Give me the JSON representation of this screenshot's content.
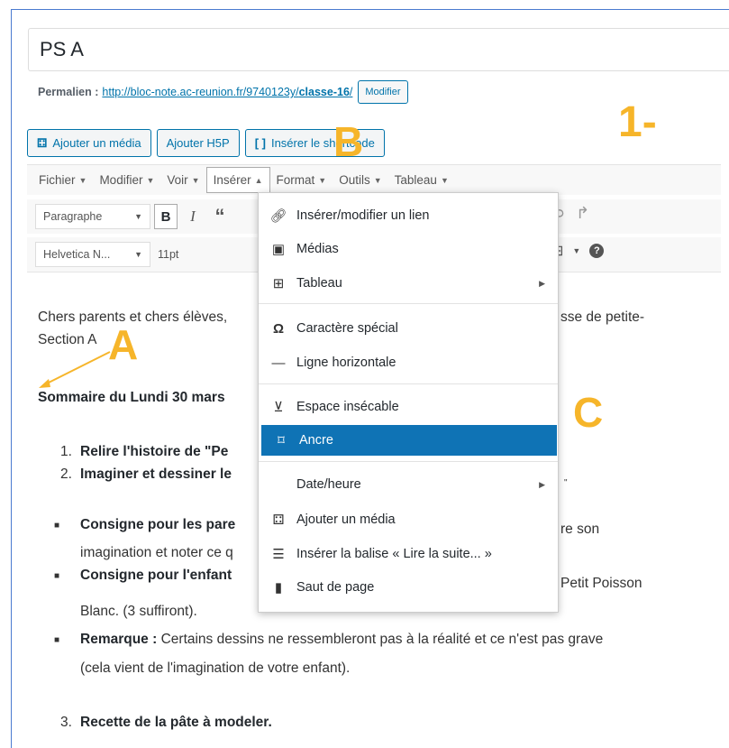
{
  "title_field": {
    "value": "PS A"
  },
  "permalink": {
    "label": "Permalien :",
    "url_base": "http://bloc-note.ac-reunion.fr/9740123y/",
    "url_slug": "classe-16",
    "url_end": "/",
    "edit_button": "Modifier"
  },
  "media_buttons": {
    "add_media": "Ajouter un média",
    "add_h5p": "Ajouter H5P",
    "shortcode_icon": "[ ]",
    "shortcode": "Insérer le shortcode"
  },
  "menubar": {
    "items": [
      {
        "label": "Fichier"
      },
      {
        "label": "Modifier"
      },
      {
        "label": "Voir"
      },
      {
        "label": "Insérer"
      },
      {
        "label": "Format"
      },
      {
        "label": "Outils"
      },
      {
        "label": "Tableau"
      }
    ],
    "active": "Insérer"
  },
  "toolbar": {
    "paragraph_select": "Paragraphe",
    "bold": "B",
    "italic": "I",
    "quote": "“",
    "font_select": "Helvetica N...",
    "size_select": "11pt"
  },
  "insert_menu": {
    "items": [
      {
        "label": "Insérer/modifier un lien",
        "icon": "link-icon"
      },
      {
        "label": "Médias",
        "icon": "film-icon"
      },
      {
        "label": "Tableau",
        "icon": "table-icon",
        "submenu": true
      },
      {
        "label": "Caractère spécial",
        "icon": "omega-icon"
      },
      {
        "label": "Ligne horizontale",
        "icon": "hr-icon"
      },
      {
        "label": "Espace insécable",
        "icon": "nbsp-icon"
      },
      {
        "label": "Ancre",
        "icon": "bookmark-icon",
        "highlighted": true
      },
      {
        "label": "Date/heure",
        "icon": "",
        "submenu": true
      },
      {
        "label": "Ajouter un média",
        "icon": "media-icon"
      },
      {
        "label": "Insérer la balise « Lire la suite... »",
        "icon": "readmore-icon"
      },
      {
        "label": "Saut de page",
        "icon": "pagebreak-icon"
      }
    ]
  },
  "content": {
    "intro_line1_left": "Chers parents et chers élèves,",
    "intro_line1_right": "sse de petite-",
    "intro_line2": "Section A",
    "summary": "Sommaire du Lundi 30 mars",
    "ol1_num": "1.",
    "ol1": "Relire l'histoire de \"Pe",
    "ol2_num": "2.",
    "ol2": "Imaginer et dessiner le",
    "ol2_tail": "\"",
    "bullet1_bold": "Consigne pour les pare",
    "bullet1_right": "re son",
    "bullet1_line2": "imagination et noter ce q",
    "bullet2_bold": "Consigne pour l'enfant",
    "bullet2_right": "Petit Poisson",
    "bullet2_line2": "Blanc. (3 suffiront).",
    "bullet3_bold": "Remarque :",
    "bullet3_text": " Certains dessins ne ressembleront pas à la réalité et ce n'est pas grave",
    "bullet3_line2": "(cela vient de l'imagination de votre enfant).",
    "ol3_num": "3.",
    "ol3": "Recette de la pâte à modeler."
  },
  "annotations": {
    "a": "A",
    "b": "B",
    "c": "C",
    "step": "1-",
    "color": "#f6b52a"
  }
}
